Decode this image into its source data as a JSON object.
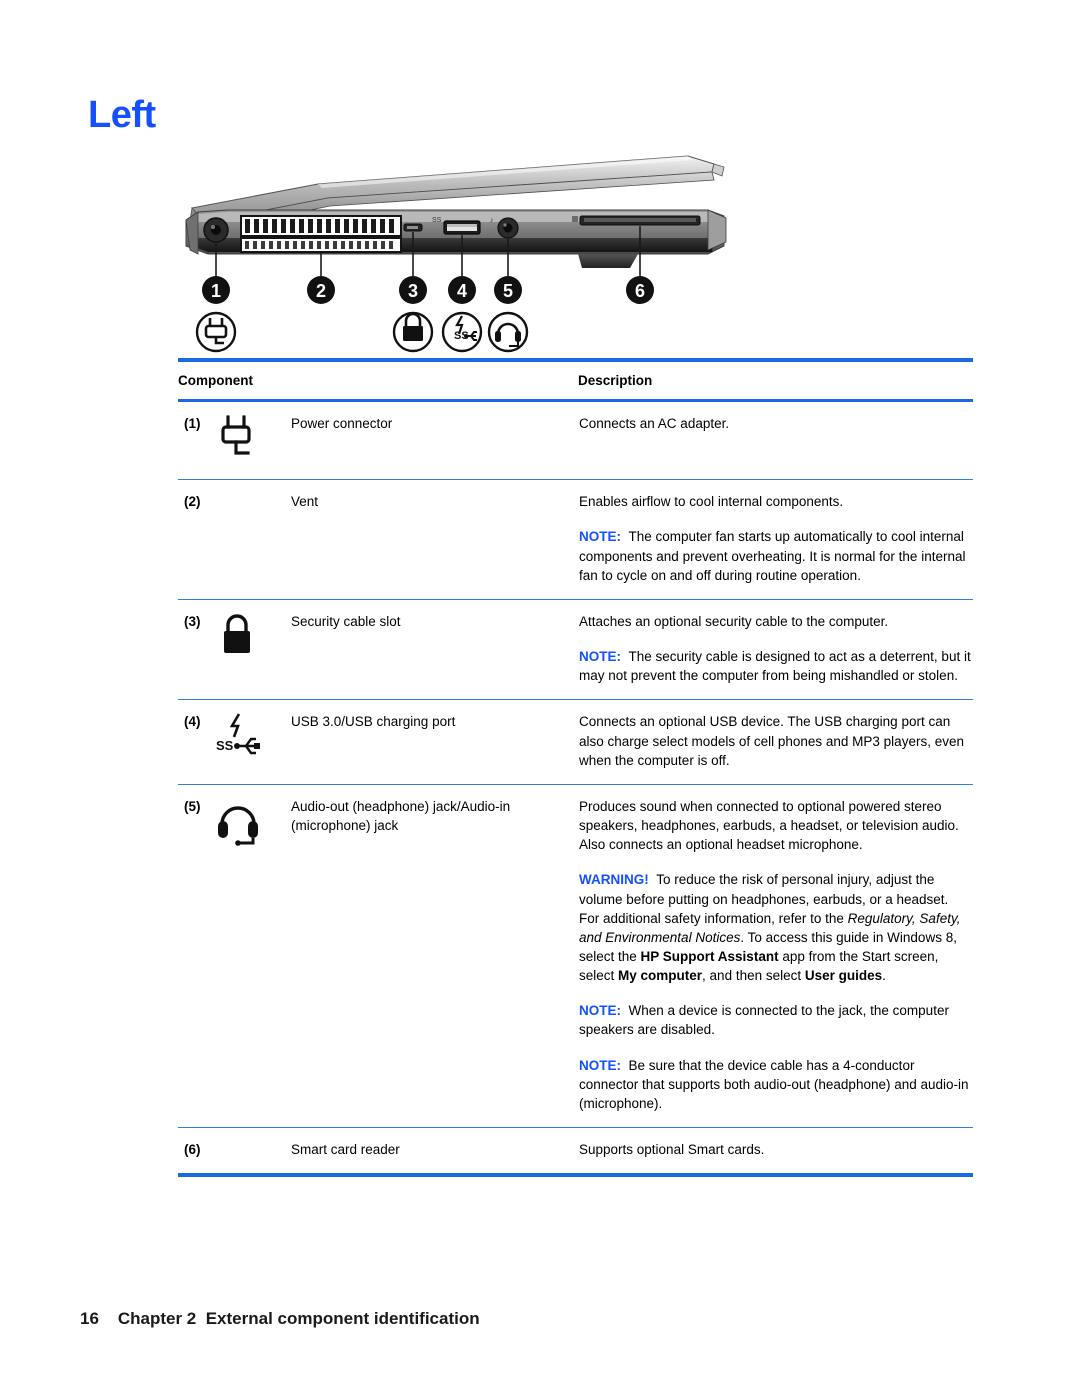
{
  "document": {
    "title": "Left",
    "title_color": "#1450ff",
    "accent_color": "#1a6ae8"
  },
  "illustration": {
    "name": "laptop-left-side-view",
    "callouts": [
      {
        "number": "1",
        "icon": "power-connector-icon"
      },
      {
        "number": "2",
        "icon": "vent-icon"
      },
      {
        "number": "3",
        "icon": "lock-icon"
      },
      {
        "number": "4",
        "icon": "usb-ss-charging-icon"
      },
      {
        "number": "5",
        "icon": "headset-icon"
      },
      {
        "number": "6",
        "icon": "smart-card-reader-icon"
      }
    ]
  },
  "table": {
    "headers": {
      "component": "Component",
      "description": "Description"
    },
    "rows": [
      {
        "num": "(1)",
        "icon": "power-connector-icon",
        "name": "Power connector",
        "desc_paras": [
          {
            "type": "plain",
            "text": "Connects an AC adapter."
          }
        ]
      },
      {
        "num": "(2)",
        "icon": "none",
        "name": "Vent",
        "desc_paras": [
          {
            "type": "plain",
            "text": "Enables airflow to cool internal components."
          },
          {
            "type": "note",
            "label": "NOTE:",
            "text": "The computer fan starts up automatically to cool internal components and prevent overheating. It is normal for the internal fan to cycle on and off during routine operation."
          }
        ]
      },
      {
        "num": "(3)",
        "icon": "lock-icon",
        "name": "Security cable slot",
        "desc_paras": [
          {
            "type": "plain",
            "text": "Attaches an optional security cable to the computer."
          },
          {
            "type": "note",
            "label": "NOTE:",
            "text": "The security cable is designed to act as a deterrent, but it may not prevent the computer from being mishandled or stolen."
          }
        ]
      },
      {
        "num": "(4)",
        "icon": "usb-ss-charging-icon",
        "name": "USB 3.0/USB charging port",
        "desc_paras": [
          {
            "type": "plain",
            "text": "Connects an optional USB device. The USB charging port can also charge select models of cell phones and MP3 players, even when the computer is off."
          }
        ]
      },
      {
        "num": "(5)",
        "icon": "headset-icon",
        "name": "Audio-out (headphone) jack/Audio-in (microphone) jack",
        "desc_paras": [
          {
            "type": "plain",
            "text": "Produces sound when connected to optional powered stereo speakers, headphones, earbuds, a headset, or television audio. Also connects an optional headset microphone."
          },
          {
            "type": "warning-rich",
            "label": "WARNING!",
            "seg1": "To reduce the risk of personal injury, adjust the volume before putting on headphones, earbuds, or a headset. For additional safety information, refer to the ",
            "italic1": "Regulatory, Safety, and Environmental Notices",
            "seg2": ". To access this guide in Windows 8, select the ",
            "bold1": "HP Support Assistant",
            "seg3": " app from the Start screen, select ",
            "bold2": "My computer",
            "seg4": ", and then select ",
            "bold3": "User guides",
            "seg5": "."
          },
          {
            "type": "note",
            "label": "NOTE:",
            "text": "When a device is connected to the jack, the computer speakers are disabled."
          },
          {
            "type": "note",
            "label": "NOTE:",
            "text": "Be sure that the device cable has a 4-conductor connector that supports both audio-out (headphone) and audio-in (microphone)."
          }
        ]
      },
      {
        "num": "(6)",
        "icon": "none",
        "name": "Smart card reader",
        "desc_paras": [
          {
            "type": "plain",
            "text": "Supports optional Smart cards."
          }
        ]
      }
    ]
  },
  "footer": {
    "page_number": "16",
    "chapter": "Chapter 2",
    "chapter_title": "External component identification"
  }
}
